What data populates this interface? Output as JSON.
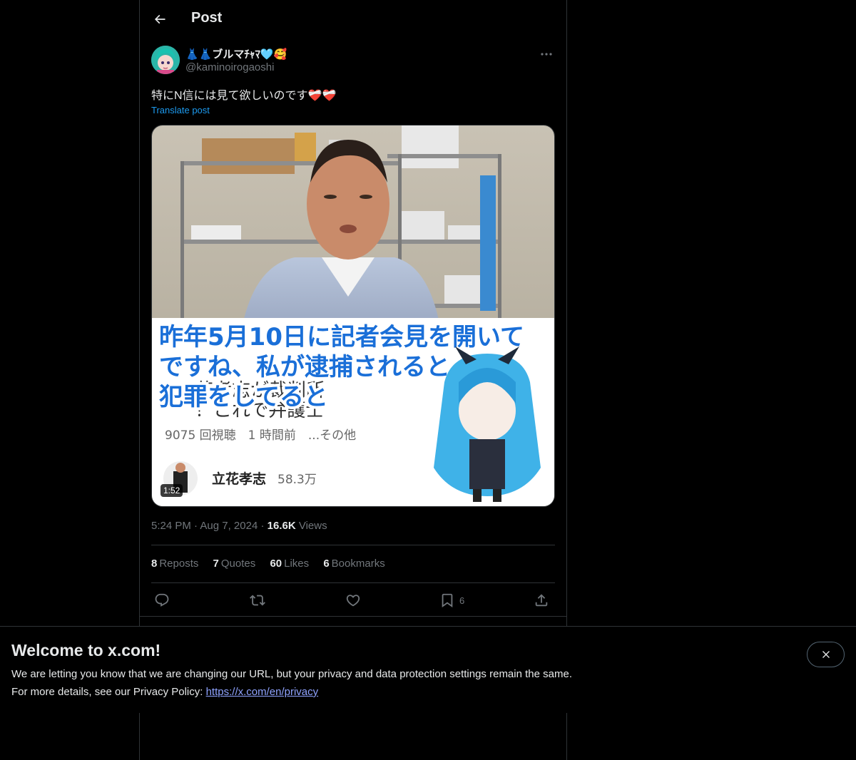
{
  "header": {
    "title": "Post"
  },
  "post": {
    "display_name": "👗👗ブルマﾁｬﾏ🩵🥰",
    "handle": "@kaminoirogaoshi",
    "text": "特にN信には見て欲しいのです❤️‍🩹❤️‍🩹",
    "translate_label": "Translate post",
    "media": {
      "caption_line1": "昨年5月10日に記者会見を開いて",
      "caption_line2": "ですね、私が逮捕されると",
      "caption_line3": "犯罪をしてると",
      "bg_text_1": "花孝志が裁判所",
      "bg_text_2": "！これで弁護士",
      "views_line": "9075 回視聴　1 時間前　...その他",
      "channel_name": "立花孝志",
      "channel_subs": "58.3万",
      "duration": "1:52"
    },
    "time": "5:24 PM",
    "date": "Aug 7, 2024",
    "views_count": "16.6K",
    "views_label": "Views",
    "stats": {
      "reposts_count": "8",
      "reposts_label": "Reposts",
      "quotes_count": "7",
      "quotes_label": "Quotes",
      "likes_count": "60",
      "likes_label": "Likes",
      "bookmarks_count": "6",
      "bookmarks_label": "Bookmarks"
    },
    "actions": {
      "bookmark_count": "6"
    }
  },
  "banner": {
    "title": "Welcome to x.com!",
    "line1": "We are letting you know that we are changing our URL, but your privacy and data protection settings remain the same.",
    "line2_prefix": "For more details, see our Privacy Policy: ",
    "link": "https://x.com/en/privacy"
  },
  "colors": {
    "accent": "#1d9bf0",
    "muted": "#71767b",
    "text": "#e7e9ea",
    "border": "#2f3336"
  }
}
